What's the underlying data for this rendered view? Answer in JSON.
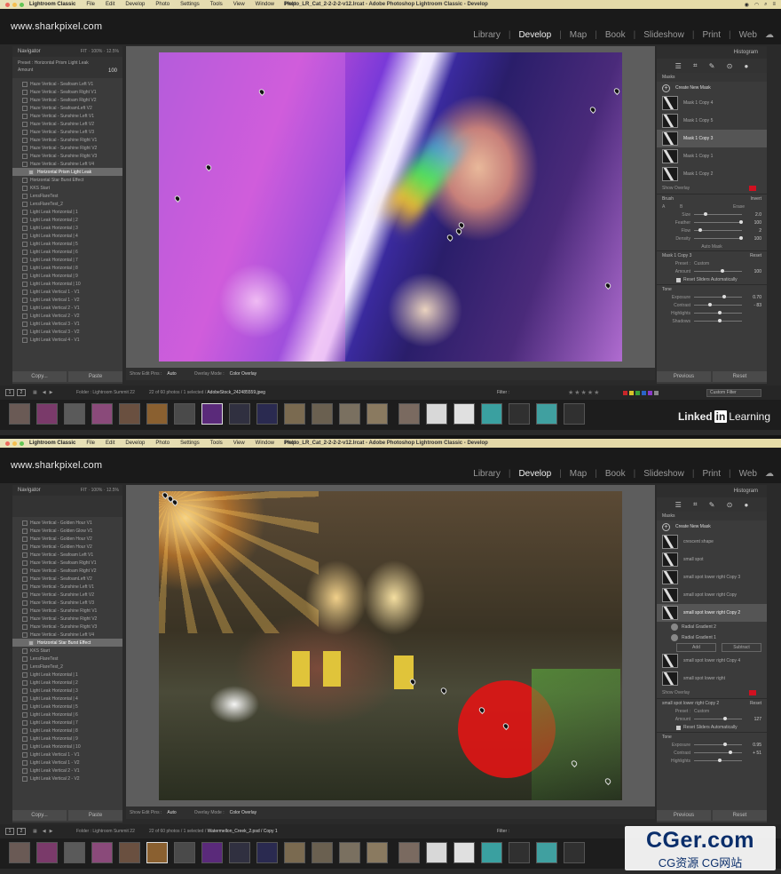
{
  "watermark": {
    "brand": "CGer.com",
    "sub": "CG资源 CG网站"
  },
  "linkedin": {
    "a": "Linked",
    "b": "in",
    "c": "Learning"
  },
  "shots": [
    {
      "menubar": {
        "app": "Lightroom Classic",
        "items": [
          "File",
          "Edit",
          "Develop",
          "Photo",
          "Settings",
          "Tools",
          "View",
          "Window",
          "Help"
        ],
        "doc": "Photo_LR_Cat_2-2-2-2-v12.lrcat - Adobe Photoshop Lightroom Classic - Develop"
      },
      "brand": "www.sharkpixel.com",
      "modules": [
        "Library",
        "Develop",
        "Map",
        "Book",
        "Slideshow",
        "Print",
        "Web"
      ],
      "navigator": {
        "title": "Navigator",
        "tabs": "FIT · 100% · 12.5%",
        "preset_label": "Preset : Horizontal Prism Light Leak",
        "amount_label": "Amount",
        "amount_value": "100"
      },
      "presets": [
        {
          "label": "Haze Vertical - Seafoam Left V1"
        },
        {
          "label": "Haze Vertical - Seafoam Right V1"
        },
        {
          "label": "Haze Vertical - Seafoam Right V2"
        },
        {
          "label": "Haze Vertical - SeafoamLeft V2"
        },
        {
          "label": "Haze Vertical - Sunshine Left V1"
        },
        {
          "label": "Haze Vertical - Sunshine Left V2"
        },
        {
          "label": "Haze Vertical - Sunshine Left V3"
        },
        {
          "label": "Haze Vertical - Sunshine Right V1"
        },
        {
          "label": "Haze Vertical - Sunshine Right V2"
        },
        {
          "label": "Haze Vertical - Sunshine Right V3"
        },
        {
          "label": "Haze Vertical - Sunshine Left V4"
        },
        {
          "label": "Horizontal Prism Light Leak",
          "sel": true
        },
        {
          "label": "Horizontal Star Burst Effect"
        },
        {
          "label": "KKS Start"
        },
        {
          "label": "LensFlareTest"
        },
        {
          "label": "LensFlareTest_2"
        },
        {
          "label": "Light Leak Horizontal | 1"
        },
        {
          "label": "Light Leak Horizontal | 2"
        },
        {
          "label": "Light Leak Horizontal | 3"
        },
        {
          "label": "Light Leak Horizontal | 4"
        },
        {
          "label": "Light Leak Horizontal | 5"
        },
        {
          "label": "Light Leak Horizontal | 6"
        },
        {
          "label": "Light Leak Horizontal | 7"
        },
        {
          "label": "Light Leak Horizontal | 8"
        },
        {
          "label": "Light Leak Horizontal | 9"
        },
        {
          "label": "Light Leak Horizontal | 10"
        },
        {
          "label": "Light Leak Vertical 1 - V1"
        },
        {
          "label": "Light Leak Vertical 1 - V2"
        },
        {
          "label": "Light Leak Vertical 2 - V1"
        },
        {
          "label": "Light Leak Vertical 2 - V2"
        },
        {
          "label": "Light Leak Vertical 3 - V1"
        },
        {
          "label": "Light Leak Vertical 3 - V2"
        },
        {
          "label": "Light Leak Vertical 4 - V1"
        }
      ],
      "left_buttons": {
        "copy": "Copy...",
        "paste": "Paste"
      },
      "toolstrip": {
        "show_edit_pins": "Show Edit Pins :",
        "pins_value": "Auto",
        "overlay_mode": "Overlay Mode :",
        "overlay_value": "Color Overlay"
      },
      "right": {
        "histogram": "Histogram",
        "masks_title": "Masks",
        "create_new": "Create New Mask",
        "masks": [
          {
            "label": "Mask 1 Copy 4"
          },
          {
            "label": "Mask 1 Copy 5"
          },
          {
            "label": "Mask 1 Copy 3",
            "sel": true
          },
          {
            "label": "Mask 1 Copy 1"
          },
          {
            "label": "Mask 1 Copy 2"
          }
        ],
        "show_overlay": "Show Overlay",
        "brush": {
          "title": "Brush",
          "invert": "Invert",
          "a": "A",
          "b": "B",
          "erase": "Erase",
          "rows": [
            {
              "label": "Size",
              "val": "2.0",
              "pos": 0.2
            },
            {
              "label": "Feather",
              "val": "100",
              "pos": 0.95
            },
            {
              "label": "Flow",
              "val": "2",
              "pos": 0.1
            },
            {
              "label": "Density",
              "val": "100",
              "pos": 0.95
            }
          ],
          "auto_mask": "Auto Mask"
        },
        "mask_section": {
          "title": "Mask 1 Copy 3",
          "reset": "Reset",
          "preset_label": "Preset :",
          "preset_value": "Custom",
          "amount_label": "Amount",
          "amount_value": "100",
          "reset_sliders": "Reset Sliders Automatically"
        },
        "tone": {
          "title": "Tone",
          "rows": [
            {
              "label": "Exposure",
              "val": "0.70",
              "pos": 0.6
            },
            {
              "label": "Contrast",
              "val": "- 83",
              "pos": 0.3
            },
            {
              "label": "Highlights",
              "val": "",
              "pos": 0.5
            },
            {
              "label": "Shadows",
              "val": "",
              "pos": 0.5
            }
          ]
        }
      },
      "right_buttons": {
        "previous": "Previous",
        "reset": "Reset"
      },
      "filmstrip_bar": {
        "folder": "Folder : Lightroom Summit 22",
        "count_text": "22 of 60 photos / 1 selected / ",
        "file": "AdobeStock_242485559.jpeg",
        "filter_label": "Filter :",
        "custom_filter": "Custom Filter"
      }
    },
    {
      "menubar": {
        "app": "Lightroom Classic",
        "items": [
          "File",
          "Edit",
          "Develop",
          "Photo",
          "Settings",
          "Tools",
          "View",
          "Window",
          "Help"
        ],
        "doc": "Photo_LR_Cat_2-2-2-2-v12.lrcat - Adobe Photoshop Lightroom Classic - Develop"
      },
      "brand": "www.sharkpixel.com",
      "modules": [
        "Library",
        "Develop",
        "Map",
        "Book",
        "Slideshow",
        "Print",
        "Web"
      ],
      "navigator": {
        "title": "Navigator",
        "tabs": "FIT · 100% · 12.5%",
        "preset_label": "",
        "amount_label": "",
        "amount_value": ""
      },
      "presets": [
        {
          "label": "Haze Vertical - Golden Hour V1"
        },
        {
          "label": "Haze Vertical - Golden Glow V1"
        },
        {
          "label": "Haze Vertical - Golden Hour V2"
        },
        {
          "label": "Haze Vertical - Golden Hour V2"
        },
        {
          "label": "Haze Vertical - Seafoam Left V1"
        },
        {
          "label": "Haze Vertical - Seafoam Right V1"
        },
        {
          "label": "Haze Vertical - Seafoam Right V2"
        },
        {
          "label": "Haze Vertical - SeafoamLeft V2"
        },
        {
          "label": "Haze Vertical - Sunshine Left V1"
        },
        {
          "label": "Haze Vertical - Sunshine Left V2"
        },
        {
          "label": "Haze Vertical - Sunshine Left V3"
        },
        {
          "label": "Haze Vertical - Sunshine Right V1"
        },
        {
          "label": "Haze Vertical - Sunshine Right V2"
        },
        {
          "label": "Haze Vertical - Sunshine Right V3"
        },
        {
          "label": "Haze Vertical - Sunshine Left V4"
        },
        {
          "label": "Horizontal Star Burst Effect",
          "sel": true
        },
        {
          "label": "KKS Start"
        },
        {
          "label": "LensFlareTest"
        },
        {
          "label": "LensFlareTest_2"
        },
        {
          "label": "Light Leak Horizontal | 1"
        },
        {
          "label": "Light Leak Horizontal | 2"
        },
        {
          "label": "Light Leak Horizontal | 3"
        },
        {
          "label": "Light Leak Horizontal | 4"
        },
        {
          "label": "Light Leak Horizontal | 5"
        },
        {
          "label": "Light Leak Horizontal | 6"
        },
        {
          "label": "Light Leak Horizontal | 7"
        },
        {
          "label": "Light Leak Horizontal | 8"
        },
        {
          "label": "Light Leak Horizontal | 9"
        },
        {
          "label": "Light Leak Horizontal | 10"
        },
        {
          "label": "Light Leak Vertical 1 - V1"
        },
        {
          "label": "Light Leak Vertical 1 - V2"
        },
        {
          "label": "Light Leak Vertical 2 - V1"
        },
        {
          "label": "Light Leak Vertical 2 - V2"
        }
      ],
      "left_buttons": {
        "copy": "Copy...",
        "paste": "Paste"
      },
      "toolstrip": {
        "show_edit_pins": "Show Edit Pins :",
        "pins_value": "Auto",
        "overlay_mode": "Overlay Mode :",
        "overlay_value": "Color Overlay"
      },
      "right": {
        "histogram": "Histogram",
        "masks_title": "Masks",
        "create_new": "Create New Mask",
        "masks": [
          {
            "label": "crescent shape"
          },
          {
            "label": "small spot"
          },
          {
            "label": "small spot lower right Copy 3"
          },
          {
            "label": "small spot lower right Copy"
          },
          {
            "label": "small spot lower right Copy 2",
            "sel": true
          }
        ],
        "subs": [
          "Radial Gradient 2",
          "Radial Gradient 1"
        ],
        "add_label": "Add",
        "subtract_label": "Subtract",
        "masks_after": [
          {
            "label": "small spot lower right Copy 4"
          },
          {
            "label": "small spot lower right"
          }
        ],
        "show_overlay": "Show Overlay",
        "mask_section": {
          "title": "small spot lower right Copy 2",
          "reset": "Reset",
          "preset_label": "Preset :",
          "preset_value": "Custom",
          "amount_label": "Amount",
          "amount_value": "127",
          "reset_sliders": "Reset Sliders Automatically"
        },
        "tone": {
          "title": "Tone",
          "rows": [
            {
              "label": "Exposure",
              "val": "0.95",
              "pos": 0.62
            },
            {
              "label": "Contrast",
              "val": "+ 51",
              "pos": 0.72
            },
            {
              "label": "Highlights",
              "val": "",
              "pos": 0.5
            }
          ]
        }
      },
      "right_buttons": {
        "previous": "Previous",
        "reset": "Reset"
      },
      "filmstrip_bar": {
        "folder": "Folder : Lightroom Summit 22",
        "count_text": "22 of 60 photos / 1 selected / ",
        "file": "Watermellon_Creek_2.psd / Copy 1",
        "filter_label": "Filter :",
        "custom_filter": ""
      }
    }
  ]
}
